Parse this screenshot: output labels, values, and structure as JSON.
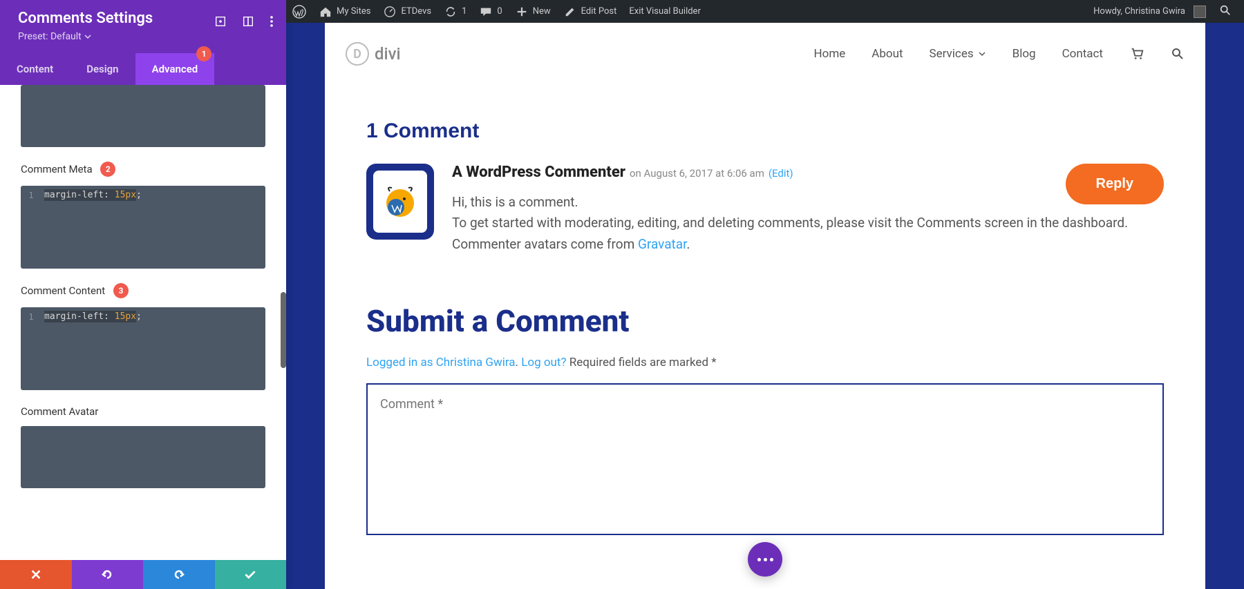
{
  "sidebar": {
    "title": "Comments Settings",
    "preset": "Preset: Default",
    "tabs": {
      "content": "Content",
      "design": "Design",
      "advanced": "Advanced",
      "badge": "1"
    },
    "fields": {
      "meta": {
        "label": "Comment Meta",
        "badge": "2",
        "line_no": "1",
        "prop": "margin-left",
        "val": "15px"
      },
      "content": {
        "label": "Comment Content",
        "badge": "3",
        "line_no": "1",
        "prop": "margin-left",
        "val": "15px"
      },
      "avatar": {
        "label": "Comment Avatar"
      }
    }
  },
  "wpbar": {
    "my_sites": "My Sites",
    "site": "ETDevs",
    "updates": "1",
    "comments": "0",
    "new": "New",
    "edit_post": "Edit Post",
    "exit_vb": "Exit Visual Builder",
    "howdy": "Howdy, Christina Gwira"
  },
  "header": {
    "logo_text": "divi",
    "nav": {
      "home": "Home",
      "about": "About",
      "services": "Services",
      "blog": "Blog",
      "contact": "Contact"
    }
  },
  "comments": {
    "heading": "1 Comment",
    "author": "A WordPress Commenter",
    "date": "on August 6, 2017 at 6:06 am",
    "edit": "(Edit)",
    "body_l1": "Hi, this is a comment.",
    "body_l2": "To get started with moderating, editing, and deleting comments, please visit the Comments screen in the dashboard.",
    "body_l3a": "Commenter avatars come from ",
    "body_l3_link": "Gravatar",
    "body_l3b": ".",
    "reply": "Reply"
  },
  "form": {
    "title": "Submit a Comment",
    "logged_in": "Logged in as Christina Gwira",
    "logout": "Log out?",
    "required": " Required fields are marked *",
    "placeholder": "Comment *"
  }
}
